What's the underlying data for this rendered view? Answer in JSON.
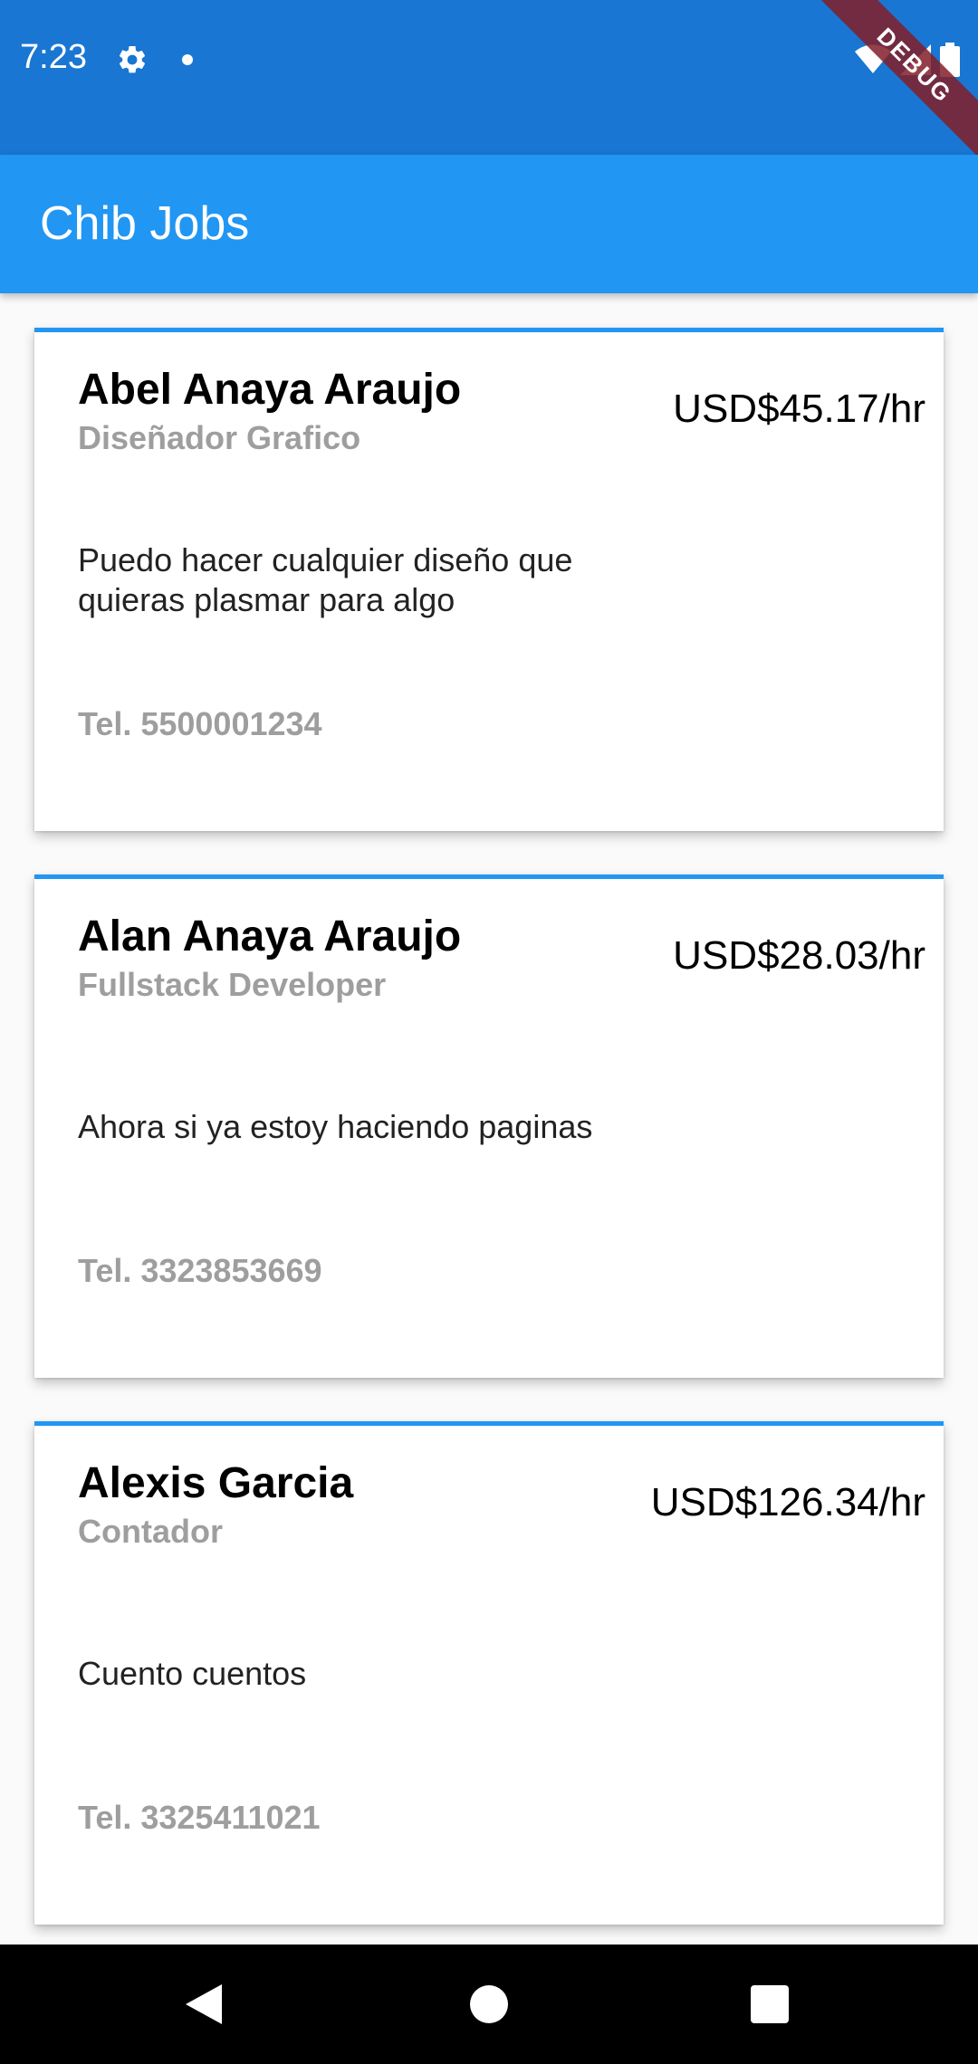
{
  "status_bar": {
    "time": "7:23",
    "debug_label": "DEBUG"
  },
  "app_bar": {
    "title": "Chib Jobs"
  },
  "cards": [
    {
      "name": "Abel Anaya Araujo",
      "role": "Diseñador Grafico",
      "rate": "USD$45.17/hr",
      "description": "Puedo hacer cualquier diseño que quieras plasmar para algo",
      "phone": "Tel. 5500001234"
    },
    {
      "name": "Alan Anaya Araujo",
      "role": "Fullstack Developer",
      "rate": "USD$28.03/hr",
      "description": "Ahora si ya estoy haciendo paginas",
      "phone": "Tel. 3323853669"
    },
    {
      "name": "Alexis Garcia",
      "role": "Contador",
      "rate": "USD$126.34/hr",
      "description": "Cuento cuentos",
      "phone": "Tel. 3325411021"
    }
  ],
  "colors": {
    "status_bar": "#1976d2",
    "app_bar": "#2196f3",
    "card_accent": "#2196f3",
    "muted_text": "#9e9e9e"
  },
  "icons": [
    "settings-gear-icon",
    "notification-dot-icon",
    "wifi-icon",
    "signal-icon",
    "battery-icon",
    "back-icon",
    "home-icon",
    "recents-icon"
  ]
}
